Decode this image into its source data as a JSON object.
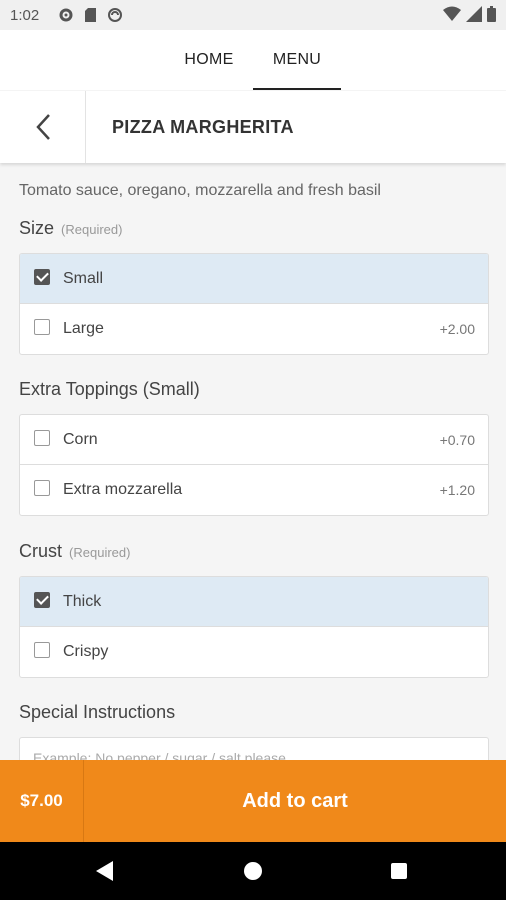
{
  "status_bar": {
    "time": "1:02"
  },
  "nav": {
    "tabs": [
      {
        "label": "HOME"
      },
      {
        "label": "MENU"
      }
    ]
  },
  "header": {
    "title": "PIZZA MARGHERITA"
  },
  "description": "Tomato sauce, oregano, mozzarella and fresh basil",
  "sections": {
    "size": {
      "title": "Size",
      "required": "(Required)",
      "options": [
        {
          "label": "Small",
          "price": "",
          "checked": true
        },
        {
          "label": "Large",
          "price": "+2.00",
          "checked": false
        }
      ]
    },
    "toppings": {
      "title": "Extra Toppings (Small)",
      "options": [
        {
          "label": "Corn",
          "price": "+0.70",
          "checked": false
        },
        {
          "label": "Extra mozzarella",
          "price": "+1.20",
          "checked": false
        }
      ]
    },
    "crust": {
      "title": "Crust",
      "required": "(Required)",
      "options": [
        {
          "label": "Thick",
          "price": "",
          "checked": true
        },
        {
          "label": "Crispy",
          "price": "",
          "checked": false
        }
      ]
    },
    "instructions": {
      "title": "Special Instructions",
      "placeholder": "Example: No pepper / sugar / salt please",
      "value": ""
    }
  },
  "cart": {
    "price": "$7.00",
    "label": "Add to cart"
  },
  "colors": {
    "accent": "#f0891a",
    "selected_bg": "#deeaf4"
  },
  "icons": [
    "settings-icon",
    "sd-card-icon",
    "sync-icon",
    "wifi-icon",
    "signal-icon",
    "battery-icon",
    "back-arrow-icon"
  ]
}
